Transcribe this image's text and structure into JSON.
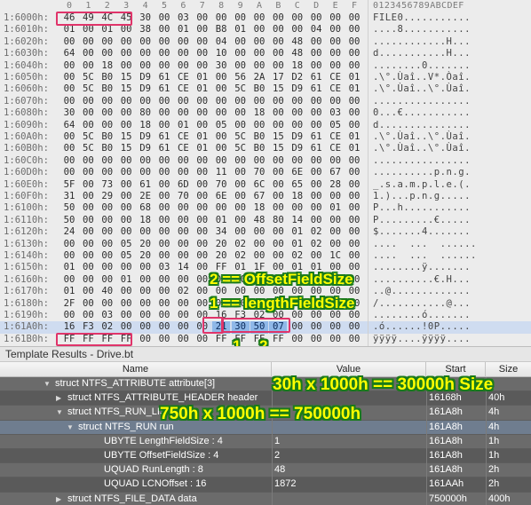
{
  "hex_editor": {
    "column_header": [
      "0",
      "1",
      "2",
      "3",
      "4",
      "5",
      "6",
      "7",
      "8",
      "9",
      "A",
      "B",
      "C",
      "D",
      "E",
      "F"
    ],
    "ascii_header": "0123456789ABCDEF",
    "rows": [
      {
        "addr": "1:6000h:",
        "bytes": [
          "46",
          "49",
          "4C",
          "45",
          "30",
          "00",
          "03",
          "00",
          "00",
          "00",
          "00",
          "00",
          "00",
          "00",
          "00",
          "00"
        ],
        "ascii": "FILE0..........."
      },
      {
        "addr": "1:6010h:",
        "bytes": [
          "01",
          "00",
          "01",
          "00",
          "38",
          "00",
          "01",
          "00",
          "B8",
          "01",
          "00",
          "00",
          "00",
          "04",
          "00",
          "00"
        ],
        "ascii": "....8..........."
      },
      {
        "addr": "1:6020h:",
        "bytes": [
          "00",
          "00",
          "00",
          "00",
          "00",
          "00",
          "00",
          "00",
          "04",
          "00",
          "00",
          "00",
          "48",
          "00",
          "00",
          "00"
        ],
        "ascii": "............H..."
      },
      {
        "addr": "1:6030h:",
        "bytes": [
          "64",
          "00",
          "00",
          "00",
          "00",
          "00",
          "00",
          "00",
          "10",
          "00",
          "00",
          "00",
          "48",
          "00",
          "00",
          "00"
        ],
        "ascii": "d...........H..."
      },
      {
        "addr": "1:6040h:",
        "bytes": [
          "00",
          "00",
          "18",
          "00",
          "00",
          "00",
          "00",
          "00",
          "30",
          "00",
          "00",
          "00",
          "18",
          "00",
          "00",
          "00"
        ],
        "ascii": "........0......."
      },
      {
        "addr": "1:6050h:",
        "bytes": [
          "00",
          "5C",
          "B0",
          "15",
          "D9",
          "61",
          "CE",
          "01",
          "00",
          "56",
          "2A",
          "17",
          "D2",
          "61",
          "CE",
          "01"
        ],
        "ascii": ".\\°.Ùaî..V*.Òaî."
      },
      {
        "addr": "1:6060h:",
        "bytes": [
          "00",
          "5C",
          "B0",
          "15",
          "D9",
          "61",
          "CE",
          "01",
          "00",
          "5C",
          "B0",
          "15",
          "D9",
          "61",
          "CE",
          "01"
        ],
        "ascii": ".\\°.Ùaî..\\°.Ùaî."
      },
      {
        "addr": "1:6070h:",
        "bytes": [
          "00",
          "00",
          "00",
          "00",
          "00",
          "00",
          "00",
          "00",
          "00",
          "00",
          "00",
          "00",
          "00",
          "00",
          "00",
          "00"
        ],
        "ascii": "................"
      },
      {
        "addr": "1:6080h:",
        "bytes": [
          "30",
          "00",
          "00",
          "00",
          "80",
          "00",
          "00",
          "00",
          "00",
          "00",
          "18",
          "00",
          "00",
          "00",
          "03",
          "00"
        ],
        "ascii": "0...€..........."
      },
      {
        "addr": "1:6090h:",
        "bytes": [
          "64",
          "00",
          "00",
          "00",
          "18",
          "00",
          "01",
          "00",
          "05",
          "00",
          "00",
          "00",
          "00",
          "00",
          "05",
          "00"
        ],
        "ascii": "d..............."
      },
      {
        "addr": "1:60A0h:",
        "bytes": [
          "00",
          "5C",
          "B0",
          "15",
          "D9",
          "61",
          "CE",
          "01",
          "00",
          "5C",
          "B0",
          "15",
          "D9",
          "61",
          "CE",
          "01"
        ],
        "ascii": ".\\°.Ùaî..\\°.Ùaî."
      },
      {
        "addr": "1:60B0h:",
        "bytes": [
          "00",
          "5C",
          "B0",
          "15",
          "D9",
          "61",
          "CE",
          "01",
          "00",
          "5C",
          "B0",
          "15",
          "D9",
          "61",
          "CE",
          "01"
        ],
        "ascii": ".\\°.Ùaî..\\°.Ùaî."
      },
      {
        "addr": "1:60C0h:",
        "bytes": [
          "00",
          "00",
          "00",
          "00",
          "00",
          "00",
          "00",
          "00",
          "00",
          "00",
          "00",
          "00",
          "00",
          "00",
          "00",
          "00"
        ],
        "ascii": "................"
      },
      {
        "addr": "1:60D0h:",
        "bytes": [
          "00",
          "00",
          "00",
          "00",
          "00",
          "00",
          "00",
          "00",
          "11",
          "00",
          "70",
          "00",
          "6E",
          "00",
          "67",
          "00"
        ],
        "ascii": "..........p.n.g."
      },
      {
        "addr": "1:60E0h:",
        "bytes": [
          "5F",
          "00",
          "73",
          "00",
          "61",
          "00",
          "6D",
          "00",
          "70",
          "00",
          "6C",
          "00",
          "65",
          "00",
          "28",
          "00"
        ],
        "ascii": "_.s.a.m.p.l.e.(."
      },
      {
        "addr": "1:60F0h:",
        "bytes": [
          "31",
          "00",
          "29",
          "00",
          "2E",
          "00",
          "70",
          "00",
          "6E",
          "00",
          "67",
          "00",
          "18",
          "00",
          "00",
          "00"
        ],
        "ascii": "1.)...p.n.g....."
      },
      {
        "addr": "1:6100h:",
        "bytes": [
          "50",
          "00",
          "00",
          "00",
          "68",
          "00",
          "00",
          "00",
          "00",
          "00",
          "18",
          "00",
          "00",
          "00",
          "01",
          "00"
        ],
        "ascii": "P...h..........."
      },
      {
        "addr": "1:6110h:",
        "bytes": [
          "50",
          "00",
          "00",
          "00",
          "18",
          "00",
          "00",
          "00",
          "01",
          "00",
          "48",
          "80",
          "14",
          "00",
          "00",
          "00"
        ],
        "ascii": "P.........€....."
      },
      {
        "addr": "1:6120h:",
        "bytes": [
          "24",
          "00",
          "00",
          "00",
          "00",
          "00",
          "00",
          "00",
          "34",
          "00",
          "00",
          "00",
          "01",
          "02",
          "00",
          "00"
        ],
        "ascii": "$.......4......."
      },
      {
        "addr": "1:6130h:",
        "bytes": [
          "00",
          "00",
          "00",
          "05",
          "20",
          "00",
          "00",
          "00",
          "20",
          "02",
          "00",
          "00",
          "01",
          "02",
          "00",
          "00"
        ],
        "ascii": "....  ...  ......"
      },
      {
        "addr": "1:6140h:",
        "bytes": [
          "00",
          "00",
          "00",
          "05",
          "20",
          "00",
          "00",
          "00",
          "20",
          "02",
          "00",
          "00",
          "02",
          "00",
          "1C",
          "00"
        ],
        "ascii": "....  ...  ......"
      },
      {
        "addr": "1:6150h:",
        "bytes": [
          "01",
          "00",
          "00",
          "00",
          "00",
          "03",
          "14",
          "00",
          "FF",
          "01",
          "1F",
          "00",
          "01",
          "01",
          "00",
          "00"
        ],
        "ascii": "........ÿ......."
      },
      {
        "addr": "1:6160h:",
        "bytes": [
          "00",
          "00",
          "00",
          "01",
          "00",
          "00",
          "00",
          "00",
          "00",
          "00",
          "00",
          "00",
          "00",
          "00",
          "00",
          "00"
        ],
        "ascii": "..........€.H..."
      },
      {
        "addr": "1:6170h:",
        "bytes": [
          "01",
          "00",
          "40",
          "00",
          "00",
          "00",
          "02",
          "00",
          "00",
          "00",
          "00",
          "00",
          "00",
          "00",
          "00",
          "00"
        ],
        "ascii": "..@............."
      },
      {
        "addr": "1:6180h:",
        "bytes": [
          "2F",
          "00",
          "00",
          "00",
          "00",
          "00",
          "00",
          "00",
          "00",
          "00",
          "00",
          "00",
          "00",
          "00",
          "00",
          "00"
        ],
        "ascii": "/...........@..."
      },
      {
        "addr": "1:6190h:",
        "bytes": [
          "00",
          "00",
          "03",
          "00",
          "00",
          "00",
          "00",
          "00",
          "16",
          "F3",
          "02",
          "00",
          "00",
          "00",
          "00",
          "00"
        ],
        "ascii": "........ó......."
      },
      {
        "addr": "1:61A0h:",
        "bytes": [
          "16",
          "F3",
          "02",
          "00",
          "00",
          "00",
          "00",
          "00",
          "21",
          "30",
          "50",
          "07",
          "00",
          "00",
          "00",
          "00"
        ],
        "ascii": ".ó......!0P....."
      },
      {
        "addr": "1:61B0h:",
        "bytes": [
          "FF",
          "FF",
          "FF",
          "FF",
          "00",
          "00",
          "00",
          "00",
          "FF",
          "FF",
          "FF",
          "FF",
          "00",
          "00",
          "00",
          "00"
        ],
        "ascii": "ÿÿÿÿ....ÿÿÿÿ...."
      }
    ]
  },
  "template_results": {
    "title": "Template Results - Drive.bt",
    "columns": {
      "name": "Name",
      "value": "Value",
      "start": "Start",
      "size": "Size"
    },
    "rows": [
      {
        "name": "struct NTFS_ATTRIBUTE attribute[3]",
        "value": "",
        "start": "",
        "size": ""
      },
      {
        "name": "struct NTFS_ATTRIBUTE_HEADER header",
        "value": "",
        "start": "16168h",
        "size": "40h"
      },
      {
        "name": "struct NTFS_RUN_LIST run",
        "value": "",
        "start": "161A8h",
        "size": "4h"
      },
      {
        "name": "struct NTFS_RUN run",
        "value": "",
        "start": "161A8h",
        "size": "4h"
      },
      {
        "name": "UBYTE LengthFieldSize : 4",
        "value": "1",
        "start": "161A8h",
        "size": "1h"
      },
      {
        "name": "UBYTE OffsetFieldSize : 4",
        "value": "2",
        "start": "161A8h",
        "size": "1h"
      },
      {
        "name": "UQUAD RunLength : 8",
        "value": "48",
        "start": "161A8h",
        "size": "2h"
      },
      {
        "name": "UQUAD LCNOffset : 16",
        "value": "1872",
        "start": "161AAh",
        "size": "2h"
      },
      {
        "name": "struct NTFS_FILE_DATA data",
        "value": "",
        "start": "750000h",
        "size": "400h"
      }
    ]
  },
  "annotations": {
    "offset_label": "2 == OffsetFieldSize",
    "length_label": "1 == lengthFieldSize",
    "marker_1": "1",
    "marker_2": "2",
    "size_note": "30h x 1000h == 30000h Size",
    "offset_note": "750h x 1000h == 750000h"
  },
  "colors": {
    "highlight_box": "#e0346a",
    "annotation_text": "#ffff00",
    "annotation_outline": "#1a7a1a",
    "selected_row": "#cfdcf0"
  }
}
